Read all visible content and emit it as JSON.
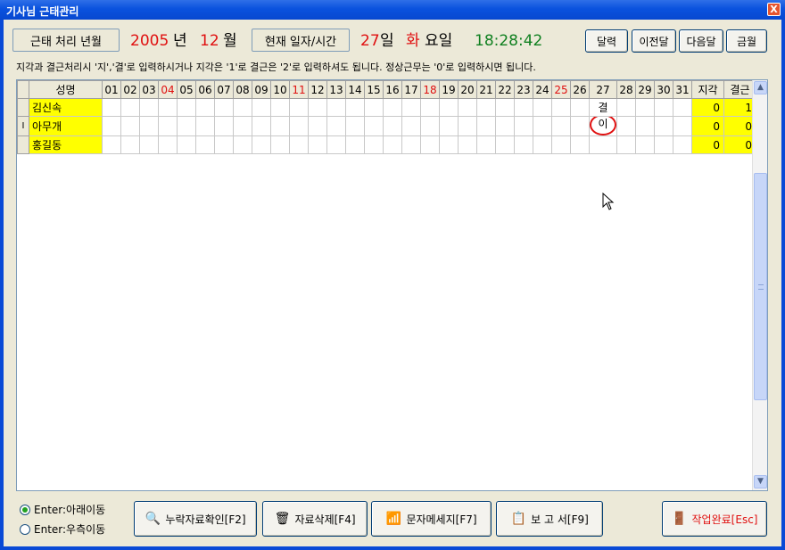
{
  "window": {
    "title": "기사님 근태관리",
    "close": "X"
  },
  "header": {
    "period_label": "근태 처리 년월",
    "year": "2005",
    "year_unit": "년",
    "month": "12",
    "month_unit": "월",
    "now_label": "현재 일자/시간",
    "day": "27",
    "day_unit": "일",
    "weekday": "화",
    "weekday_unit": "요일",
    "time": "18:28:42"
  },
  "toolbar": {
    "calendar": "달력",
    "prev_month": "이전달",
    "next_month": "다음달",
    "this_month": "금월"
  },
  "instruction": "지각과 결근처리시 '지','결'로 입력하시거나 지각은 '1'로 결근은 '2'로 입력하셔도 됩니다.  정상근무는 '0'로 입력하시면 됩니다.",
  "grid": {
    "name_header": "성명",
    "days": [
      "01",
      "02",
      "03",
      "04",
      "05",
      "06",
      "07",
      "08",
      "09",
      "10",
      "11",
      "12",
      "13",
      "14",
      "15",
      "16",
      "17",
      "18",
      "19",
      "20",
      "21",
      "22",
      "23",
      "24",
      "25",
      "26",
      "27",
      "28",
      "29",
      "30",
      "31"
    ],
    "red_days": [
      "04",
      "11",
      "18",
      "25"
    ],
    "late_header": "지각",
    "absent_header": "결근",
    "rows": [
      {
        "name": "김신속",
        "marks": {
          "27": "결"
        },
        "late": "0",
        "absent": "1",
        "indicator": ""
      },
      {
        "name": "아무개",
        "marks": {
          "27": "이"
        },
        "late": "0",
        "absent": "0",
        "indicator": "I"
      },
      {
        "name": "홍길동",
        "marks": {},
        "late": "0",
        "absent": "0",
        "indicator": ""
      }
    ],
    "highlight": {
      "row": 1,
      "day": "27"
    }
  },
  "footer": {
    "radio_down": "Enter:아래이동",
    "radio_right": "Enter:우측이동",
    "radio_selected": "down",
    "btn_missing": "누락자료확인[F2]",
    "btn_delete": "자료삭제[F4]",
    "btn_sms": "문자메세지[F7]",
    "btn_report": "보 고 서[F9]",
    "btn_done": "작업완료[Esc]"
  },
  "colors": {
    "accent_red": "#e01010",
    "time_green": "#108020",
    "total_yellow": "#ffff00"
  }
}
